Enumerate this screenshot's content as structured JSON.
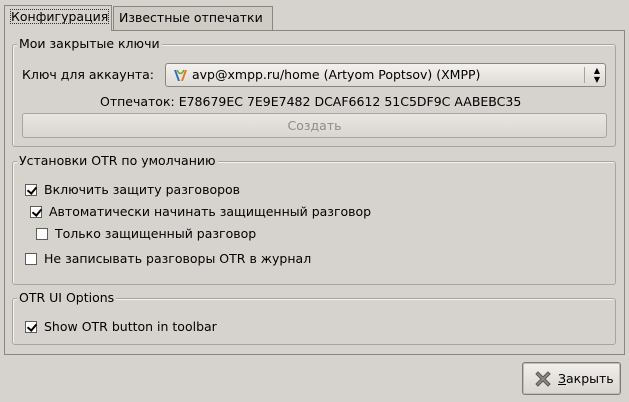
{
  "tabs": [
    {
      "label": "Конфигурация",
      "active": true
    },
    {
      "label": "Известные отпечатки",
      "active": false
    }
  ],
  "keys_group": {
    "title": "Мои закрытые ключи",
    "account_label": "Ключ для аккаунта:",
    "account_value": "avp@xmpp.ru/home (Artyom Poptsov) (XMPP)",
    "account_icon": "xmpp-icon",
    "fingerprint_text": "Отпечаток: E78679EC 7E9E7482 DCAF6612 51C5DF9C AABEBC35",
    "create_label": "Создать"
  },
  "otr_defaults": {
    "title": "Установки OTR по умолчанию",
    "options": [
      {
        "label": "Включить защиту разговоров",
        "checked": true
      },
      {
        "label": "Автоматически начинать защищенный разговор",
        "checked": true
      },
      {
        "label": "Только защищенный разговор",
        "checked": false
      },
      {
        "label": "Не записывать разговоры OTR в журнал",
        "checked": false
      }
    ]
  },
  "ui_options": {
    "title": "OTR UI Options",
    "options": [
      {
        "label": "Show OTR button in toolbar",
        "checked": true
      }
    ]
  },
  "close_button": {
    "mnemonic": "З",
    "rest": "акрыть",
    "icon": "close-icon"
  }
}
